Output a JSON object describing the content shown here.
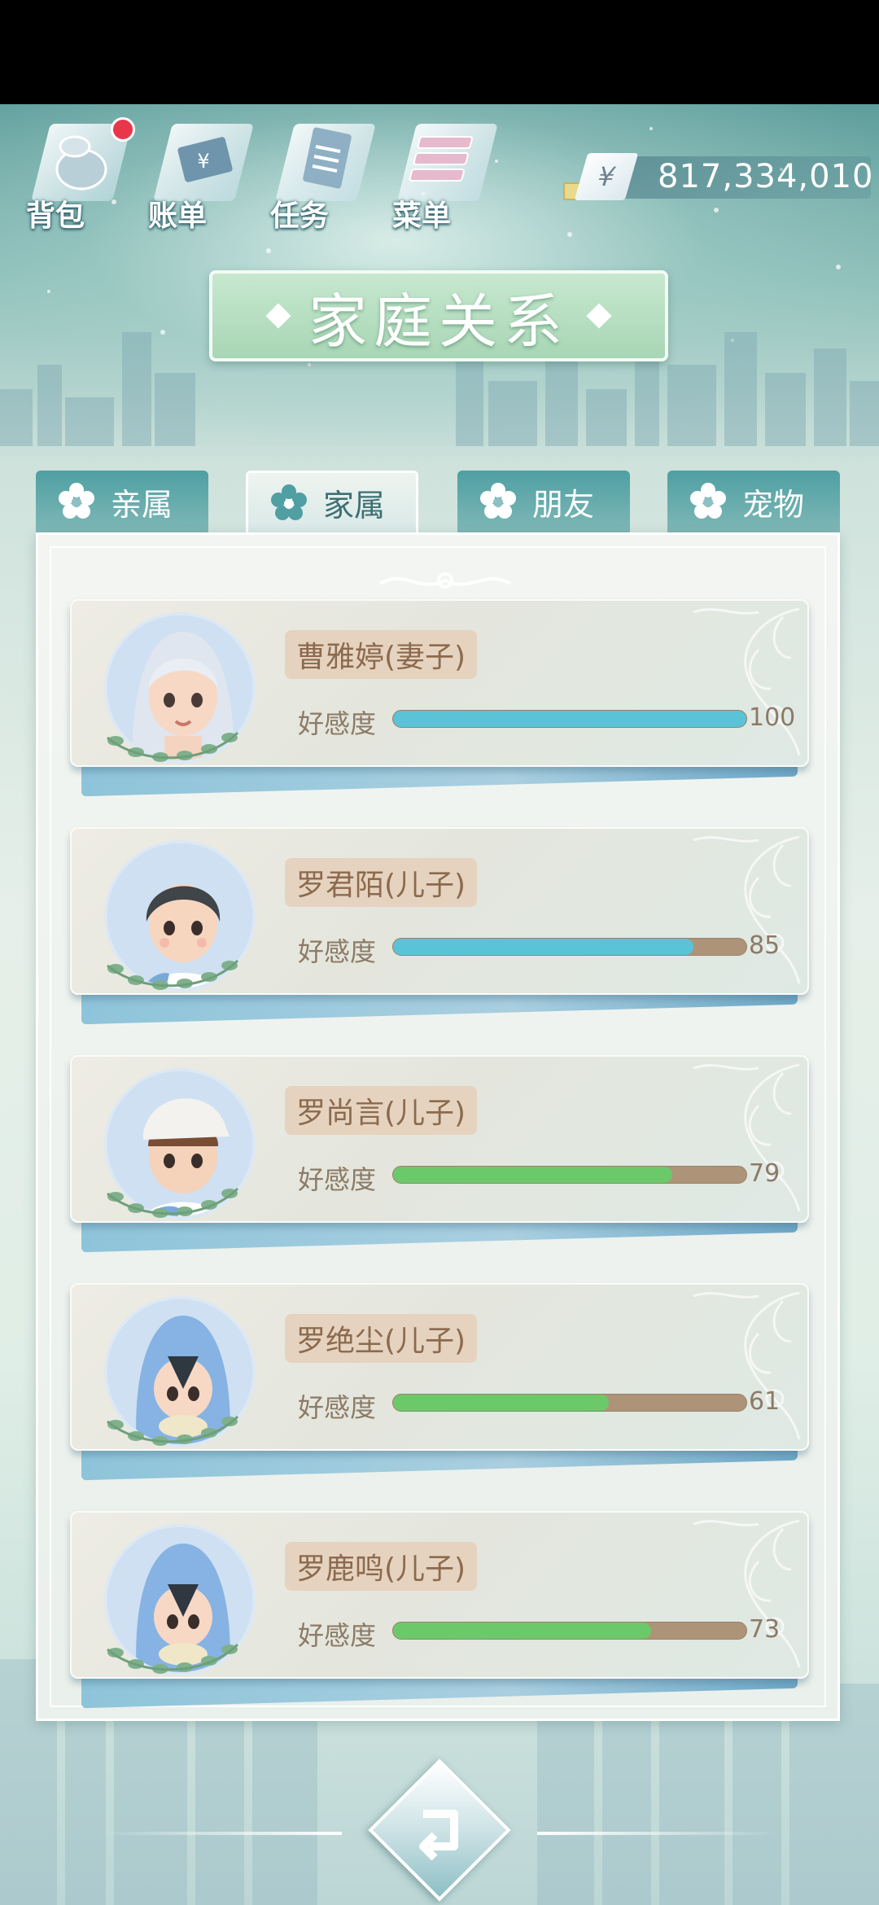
{
  "nav": {
    "items": [
      {
        "label": "背包",
        "icon": "bag-icon",
        "badge": true
      },
      {
        "label": "账单",
        "icon": "bill-icon",
        "badge": false
      },
      {
        "label": "任务",
        "icon": "task-icon",
        "badge": false
      },
      {
        "label": "菜单",
        "icon": "menu-icon",
        "badge": false
      }
    ]
  },
  "money": {
    "symbol": "¥",
    "value": "817,334,010"
  },
  "title": "家庭关系",
  "tabs": [
    {
      "label": "亲属",
      "active": false
    },
    {
      "label": "家属",
      "active": true
    },
    {
      "label": "朋友",
      "active": false
    },
    {
      "label": "宠物",
      "active": false
    }
  ],
  "members": [
    {
      "name": "曹雅婷(妻子)",
      "affinity_label": "好感度",
      "affinity": 100,
      "bar_color": "#5bc3d8",
      "avatar": "girl-silver-hair"
    },
    {
      "name": "罗君陌(儿子)",
      "affinity_label": "好感度",
      "affinity": 85,
      "bar_color": "#5bc3d8",
      "avatar": "boy-dark-hair"
    },
    {
      "name": "罗尚言(儿子)",
      "affinity_label": "好感度",
      "affinity": 79,
      "bar_color": "#6cc96a",
      "avatar": "boy-white-cap"
    },
    {
      "name": "罗绝尘(儿子)",
      "affinity_label": "好感度",
      "affinity": 61,
      "bar_color": "#6cc96a",
      "avatar": "child-blue-costume"
    },
    {
      "name": "罗鹿鸣(儿子)",
      "affinity_label": "好感度",
      "affinity": 73,
      "bar_color": "#6cc96a",
      "avatar": "child-blue-costume"
    }
  ],
  "colors": {
    "tab_inactive": "#4f9fa3",
    "name_tag": "#e6d3bf",
    "bar_track": "#ad9479"
  }
}
